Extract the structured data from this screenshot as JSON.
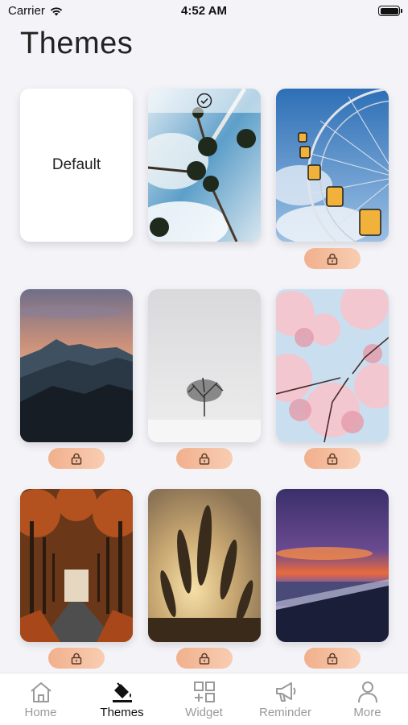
{
  "status": {
    "carrier": "Carrier",
    "time": "4:52 AM"
  },
  "page": {
    "title": "Themes"
  },
  "themes": [
    {
      "label": "Default",
      "state": "default"
    },
    {
      "label": "",
      "state": "selected",
      "scene": "palm-trees"
    },
    {
      "label": "",
      "state": "locked",
      "scene": "ferris-wheel"
    },
    {
      "label": "",
      "state": "locked",
      "scene": "mountains-dusk"
    },
    {
      "label": "",
      "state": "locked",
      "scene": "lone-tree-snow"
    },
    {
      "label": "",
      "state": "locked",
      "scene": "cherry-blossom"
    },
    {
      "label": "",
      "state": "locked",
      "scene": "autumn-path"
    },
    {
      "label": "",
      "state": "locked",
      "scene": "wheat-sunset"
    },
    {
      "label": "",
      "state": "locked",
      "scene": "beach-sunset"
    }
  ],
  "tabs": [
    {
      "label": "Home",
      "icon": "home-icon",
      "active": false
    },
    {
      "label": "Themes",
      "icon": "paint-bucket-icon",
      "active": true
    },
    {
      "label": "Widget",
      "icon": "widget-icon",
      "active": false
    },
    {
      "label": "Reminder",
      "icon": "megaphone-icon",
      "active": false
    },
    {
      "label": "More",
      "icon": "person-icon",
      "active": false
    }
  ],
  "colors": {
    "accent": "#f1b08c",
    "active_tab": "#111111",
    "inactive_tab": "#9a9a9a"
  }
}
